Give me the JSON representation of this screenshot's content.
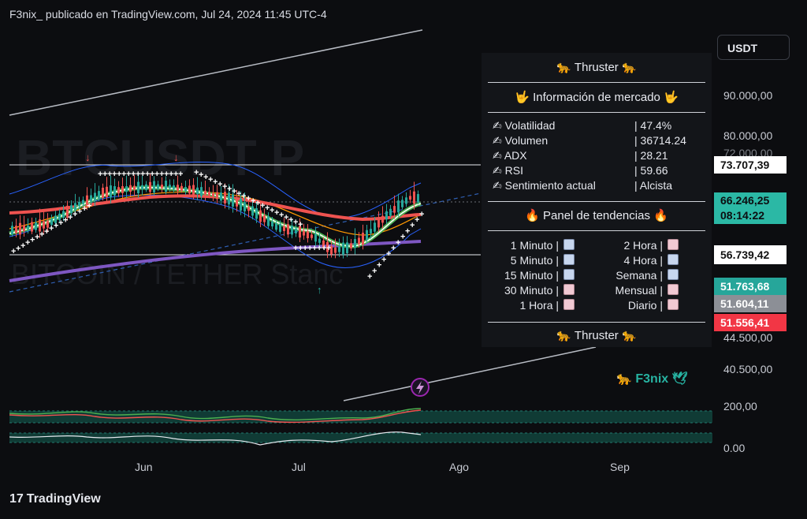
{
  "header": {
    "text": "F3nix_ publicado en TradingView.com, Jul 24, 2024 11:45 UTC-4"
  },
  "watermark": {
    "symbol": "BTCUSDT P",
    "description": "BITCOIN / TETHER Stanc"
  },
  "currency": "USDT",
  "y_axis": {
    "labels": [
      "90.000,00",
      "80.000,00",
      "72.000,00",
      "44.500,00",
      "40.500,00",
      "200,00",
      "0.00"
    ],
    "price_boxes": [
      {
        "value": "73.707,39",
        "bg": "#ffffff",
        "fg": "#111111"
      },
      {
        "value": "66.246,25",
        "sub": "08:14:22",
        "bg": "#2bb8a5",
        "fg": "#0c0d10"
      },
      {
        "value": "56.739,42",
        "bg": "#ffffff",
        "fg": "#111111"
      },
      {
        "value": "51.763,68",
        "bg": "#26a69a",
        "fg": "#ffffff"
      },
      {
        "value": "51.604,11",
        "bg": "#8c8f96",
        "fg": "#ffffff"
      },
      {
        "value": "51.556,41",
        "bg": "#f23645",
        "fg": "#ffffff"
      }
    ]
  },
  "x_axis": {
    "labels": [
      "Jun",
      "Jul",
      "Ago",
      "Sep"
    ]
  },
  "panel": {
    "title": "🐆 Thruster 🐆",
    "market_title": "🤟 Información de mercado 🤟",
    "metrics": [
      {
        "label": "✍ Volatilidad",
        "value": "| 47.4%"
      },
      {
        "label": "✍ Volumen",
        "value": "| 36714.24"
      },
      {
        "label": "✍ ADX",
        "value": "| 28.21"
      },
      {
        "label": "✍ RSI",
        "value": "| 59.66"
      },
      {
        "label": "✍ Sentimiento actual",
        "value": "| Alcista"
      }
    ],
    "trend_title": "🔥 Panel de tendencias 🔥",
    "trends_left": [
      {
        "label": "1 Minuto |",
        "dir": "up"
      },
      {
        "label": "5 Minuto |",
        "dir": "up"
      },
      {
        "label": "15 Minuto |",
        "dir": "up"
      },
      {
        "label": "30 Minuto |",
        "dir": "down"
      },
      {
        "label": "1 Hora |",
        "dir": "down"
      }
    ],
    "trends_right": [
      {
        "label": "2 Hora |",
        "dir": "down"
      },
      {
        "label": "4 Hora |",
        "dir": "up"
      },
      {
        "label": "Semana |",
        "dir": "up"
      },
      {
        "label": "Mensual |",
        "dir": "down"
      },
      {
        "label": "Diario |",
        "dir": "down"
      }
    ],
    "footer": "🐆 Thruster 🐆"
  },
  "author_tag": "🐆 F3nix 🕊",
  "logo": "TradingView",
  "colors": {
    "up": "#26a69a",
    "down": "#ef5350",
    "accent": "#7e57c2",
    "ema_fast": "#ef5350",
    "ema_green": "#4caf50"
  }
}
